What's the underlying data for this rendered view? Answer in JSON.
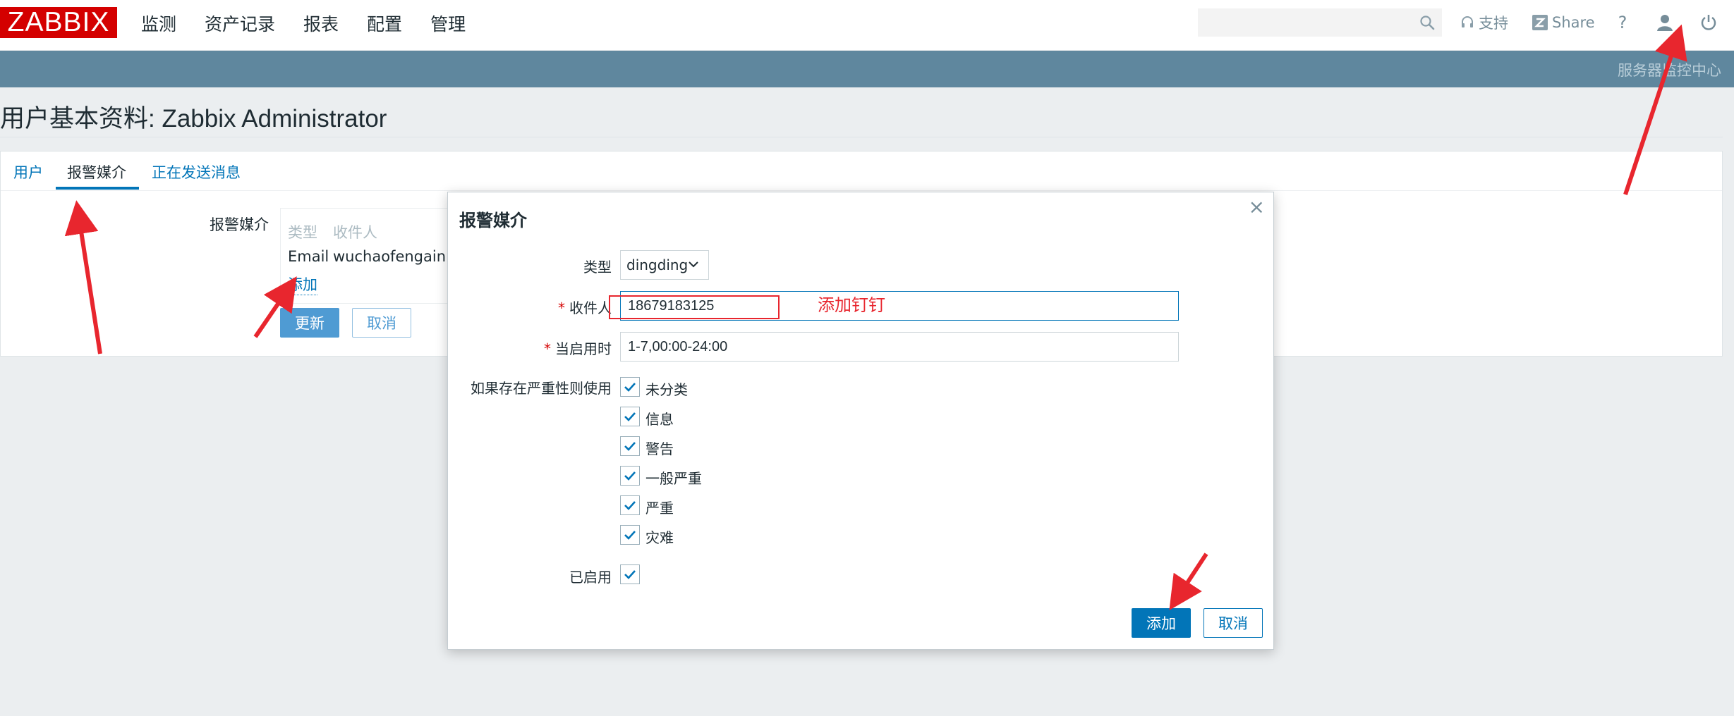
{
  "header": {
    "logo": "ZABBIX",
    "menu": [
      "监测",
      "资产记录",
      "报表",
      "配置",
      "管理"
    ],
    "search_placeholder": "",
    "support_label": "支持",
    "share_label": "Share",
    "help_label": "?"
  },
  "strip": {
    "server_name": "服务器监控中心"
  },
  "page": {
    "title": "用户基本资料: Zabbix Administrator"
  },
  "tabs": [
    "用户",
    "报警媒介",
    "正在发送消息"
  ],
  "media": {
    "label": "报警媒介",
    "col_type": "类型",
    "col_recipient": "收件人",
    "row_type": "Email",
    "row_recipient": "wuchaofengainio",
    "add_link": "添加",
    "update_button": "更新",
    "cancel_button": "取消"
  },
  "modal": {
    "title": "报警媒介",
    "close": "×",
    "type_label": "类型",
    "type_value": "dingding",
    "recipient_label": "收件人",
    "recipient_value": "18679183125",
    "when_label": "当启用时",
    "when_value": "1-7,00:00-24:00",
    "severity_label": "如果存在严重性则使用",
    "severities": [
      "未分类",
      "信息",
      "警告",
      "一般严重",
      "严重",
      "灾难"
    ],
    "enabled_label": "已启用",
    "add_button": "添加",
    "cancel_button": "取消",
    "annotation": "添加钉钉"
  },
  "colors": {
    "brand": "#d40000",
    "accent": "#0275b8",
    "strip": "#5f879e",
    "annotation": "#e8262e"
  }
}
